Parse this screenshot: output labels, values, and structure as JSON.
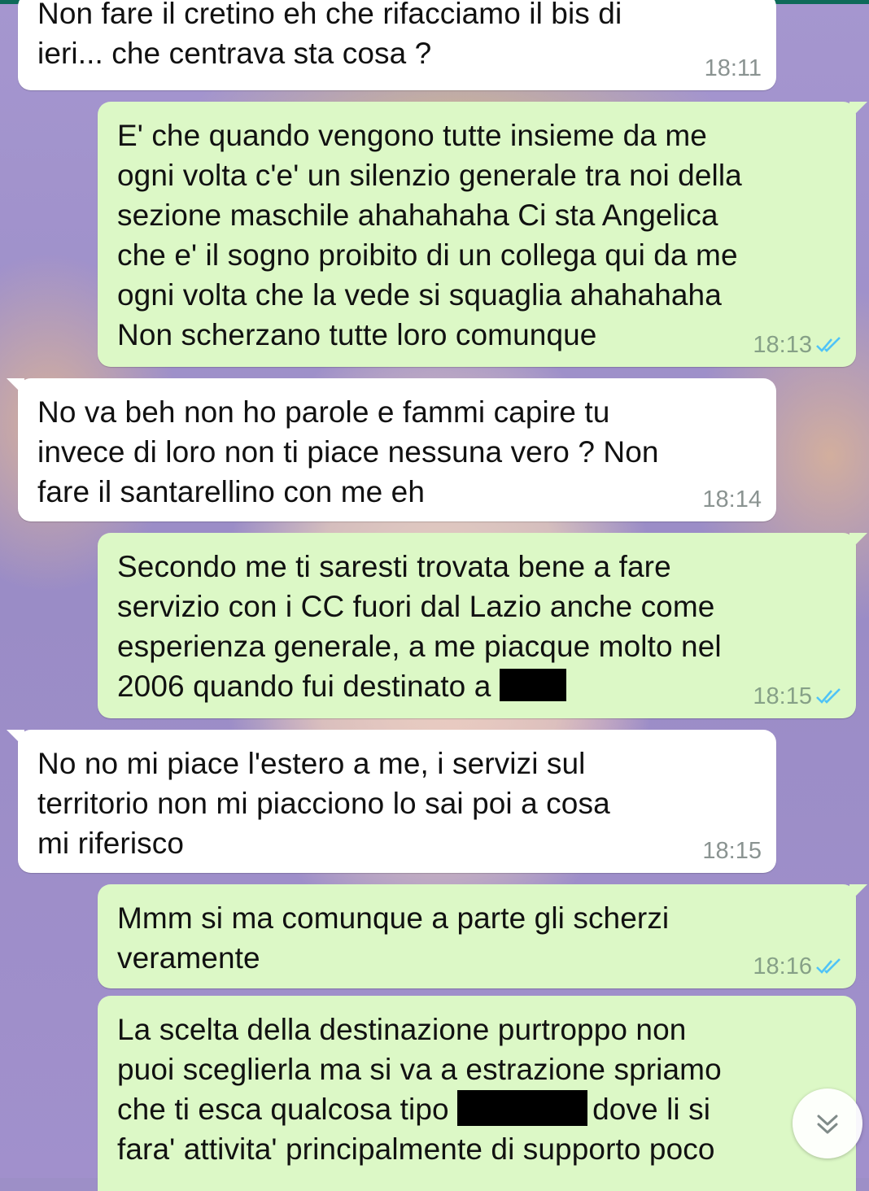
{
  "chat": {
    "messages": [
      {
        "direction": "in",
        "text": "Non fare il cretino eh che rifacciamo il bis di\nieri... che centrava sta cosa ?",
        "time": "18:11"
      },
      {
        "direction": "out",
        "text": "E' che quando vengono tutte insieme da me\nogni volta c'e' un silenzio generale tra noi della\nsezione maschile ahahahaha Ci sta Angelica\nche e' il sogno proibito di un collega qui da me\nogni volta che la vede si squaglia ahahahaha\nNon scherzano tutte loro comunque",
        "time": "18:13",
        "status": "read"
      },
      {
        "direction": "in",
        "text": "No va beh non ho parole e fammi capire tu\ninvece di loro non ti piace nessuna vero ? Non\nfare il santarellino con me eh",
        "time": "18:14"
      },
      {
        "direction": "out",
        "text_before_redaction": "Secondo me ti saresti trovata bene a fare\nservizio con i CC fuori dal Lazio anche come\nesperienza generale, a me piacque molto nel\n2006 quando fui destinato a ",
        "redacted": true,
        "time": "18:15",
        "status": "read"
      },
      {
        "direction": "in",
        "text": "No no mi piace l'estero a me, i servizi sul\nterritorio non mi piacciono lo sai poi a cosa\nmi riferisco",
        "time": "18:15"
      },
      {
        "direction": "out",
        "text": "Mmm si ma comunque a parte gli scherzi\nveramente",
        "time": "18:16",
        "status": "read"
      },
      {
        "direction": "out",
        "text_line1": "La scelta della destinazione purtroppo non",
        "text_line2": "puoi sceglierla ma si va a estrazione spriamo",
        "text_line3_before": "che ti esca qualcosa tipo ",
        "text_line3_after": "dove li si",
        "text_line4": "fara' attivita' principalmente di supporto poco",
        "redacted": true
      }
    ]
  },
  "icons": {
    "read_ticks": "double-check-icon",
    "scroll_down": "chevron-double-down-icon"
  },
  "colors": {
    "incoming_bubble": "#ffffff",
    "outgoing_bubble": "#dcf8c6",
    "read_ticks": "#4fc3f7",
    "header_bar": "#0e6a59",
    "wallpaper_purple": "#9d8fc7"
  }
}
